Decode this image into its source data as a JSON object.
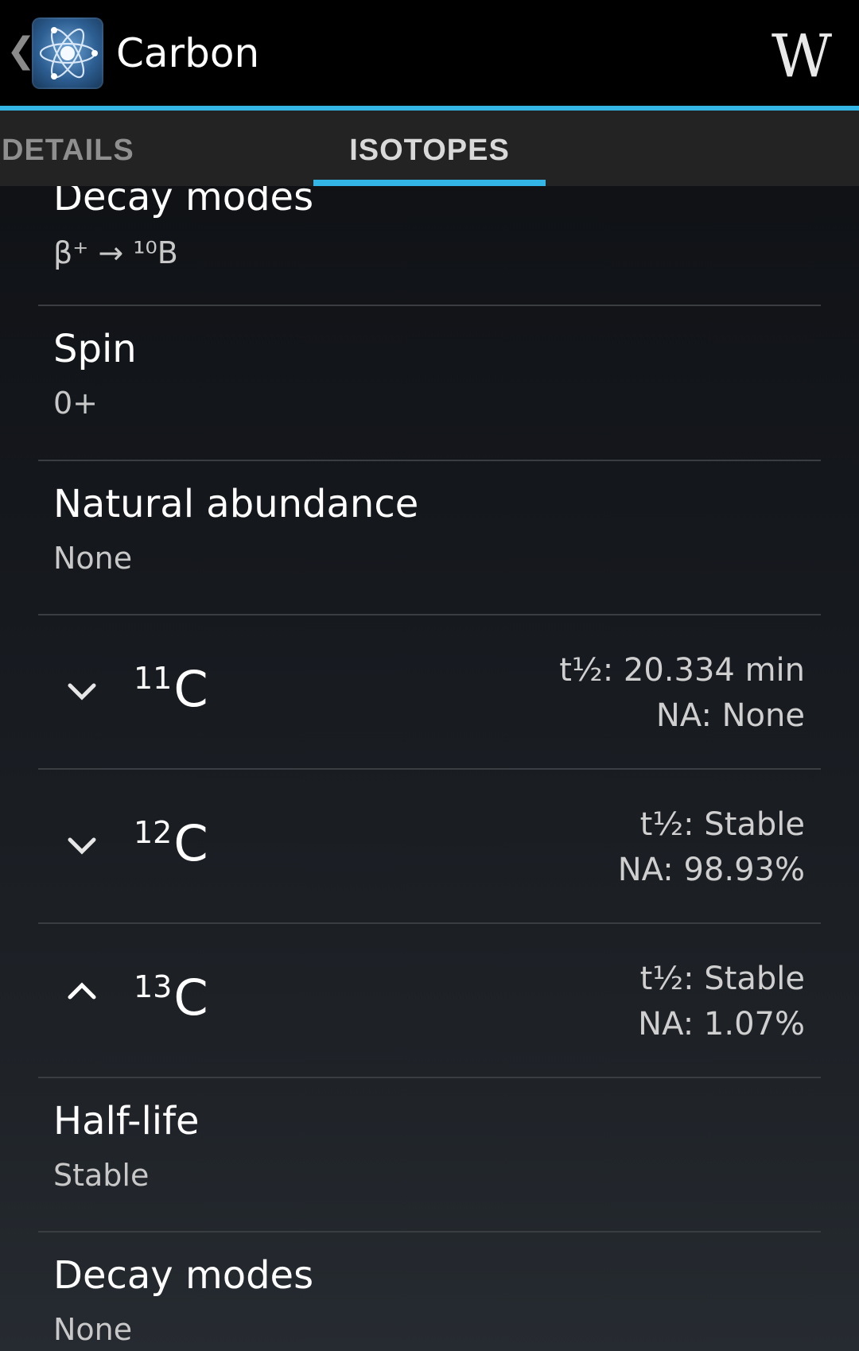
{
  "actionbar": {
    "title": "Carbon",
    "up_caret": "❮",
    "wiki_label": "W"
  },
  "tabs": [
    {
      "label": "DETAILS"
    },
    {
      "label": "ISOTOPES"
    }
  ],
  "active_tab": "ISOTOPES",
  "colors": {
    "accent": "#33b5e5"
  },
  "top_fields": [
    {
      "label": "Decay modes",
      "value": "β⁺ → ¹⁰B"
    },
    {
      "label": "Spin",
      "value": "0+"
    },
    {
      "label": "Natural abundance",
      "value": "None"
    }
  ],
  "isotopes": [
    {
      "mass": "11",
      "symbol": "C",
      "half_life": "t½: 20.334 min",
      "abundance": "NA: None",
      "expanded": false
    },
    {
      "mass": "12",
      "symbol": "C",
      "half_life": "t½: Stable",
      "abundance": "NA: 98.93%",
      "expanded": false
    },
    {
      "mass": "13",
      "symbol": "C",
      "half_life": "t½: Stable",
      "abundance": "NA: 1.07%",
      "expanded": true
    }
  ],
  "expanded_fields": [
    {
      "label": "Half-life",
      "value": "Stable"
    },
    {
      "label": "Decay modes",
      "value": "None"
    }
  ]
}
